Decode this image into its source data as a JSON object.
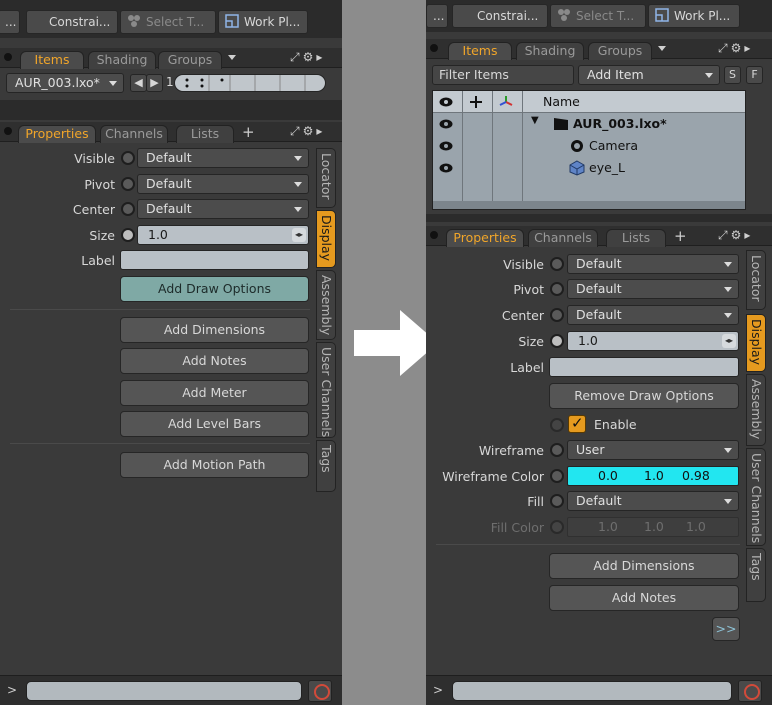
{
  "left": {
    "toolbar": {
      "dots": "...",
      "constraints": "Constrai...",
      "select_tool": "Select T...",
      "work_plane": "Work Pl..."
    },
    "item_tabs": [
      "Items",
      "Shading",
      "Groups"
    ],
    "scene_select": "AUR_003.lxo*",
    "scene_index": "1",
    "prop_tabs": [
      "Properties",
      "Channels",
      "Lists"
    ],
    "plus": "+",
    "props": {
      "visible_label": "Visible",
      "visible_value": "Default",
      "pivot_label": "Pivot",
      "pivot_value": "Default",
      "center_label": "Center",
      "center_value": "Default",
      "size_label": "Size",
      "size_value": "1.0",
      "label_label": "Label"
    },
    "buttons": {
      "draw_options": "Add Draw Options",
      "dimensions": "Add Dimensions",
      "notes": "Add Notes",
      "meter": "Add Meter",
      "level_bars": "Add Level Bars",
      "motion_path": "Add Motion Path"
    },
    "side_tabs": [
      "Locator",
      "Display",
      "Assembly",
      "User Channels",
      "Tags"
    ],
    "bottom_prompt": ">"
  },
  "right": {
    "toolbar": {
      "dots": "...",
      "constraints": "Constrai...",
      "select_tool": "Select T...",
      "work_plane": "Work Pl..."
    },
    "item_tabs": [
      "Items",
      "Shading",
      "Groups"
    ],
    "filter_label": "Filter Items",
    "add_item": "Add Item",
    "btn_s": "S",
    "btn_f": "F",
    "list": {
      "name_header": "Name",
      "rows": [
        {
          "name": "AUR_003.lxo*",
          "bold": true
        },
        {
          "name": "Camera"
        },
        {
          "name": "eye_L"
        }
      ]
    },
    "prop_tabs": [
      "Properties",
      "Channels",
      "Lists"
    ],
    "plus": "+",
    "props": {
      "visible_label": "Visible",
      "visible_value": "Default",
      "pivot_label": "Pivot",
      "pivot_value": "Default",
      "center_label": "Center",
      "center_value": "Default",
      "size_label": "Size",
      "size_value": "1.0",
      "label_label": "Label",
      "remove_draw_options": "Remove Draw Options",
      "enable_label": "Enable",
      "wireframe_label": "Wireframe",
      "wireframe_value": "User",
      "wireframe_color_label": "Wireframe Color",
      "wireframe_color": [
        "0.0",
        "1.0",
        "0.98"
      ],
      "fill_label": "Fill",
      "fill_value": "Default",
      "fill_color_label": "Fill Color",
      "fill_color": [
        "1.0",
        "1.0",
        "1.0"
      ]
    },
    "buttons": {
      "dimensions": "Add Dimensions",
      "notes": "Add Notes",
      "more": ">>"
    },
    "side_tabs": [
      "Locator",
      "Display",
      "Assembly",
      "User Channels",
      "Tags"
    ],
    "bottom_prompt": ">"
  },
  "colors": {
    "accent": "#e59a1f",
    "wireframe_cyan": "#22e6f0",
    "panel_bg": "#3a3a3a",
    "teal_button": "#7fa9a5"
  }
}
